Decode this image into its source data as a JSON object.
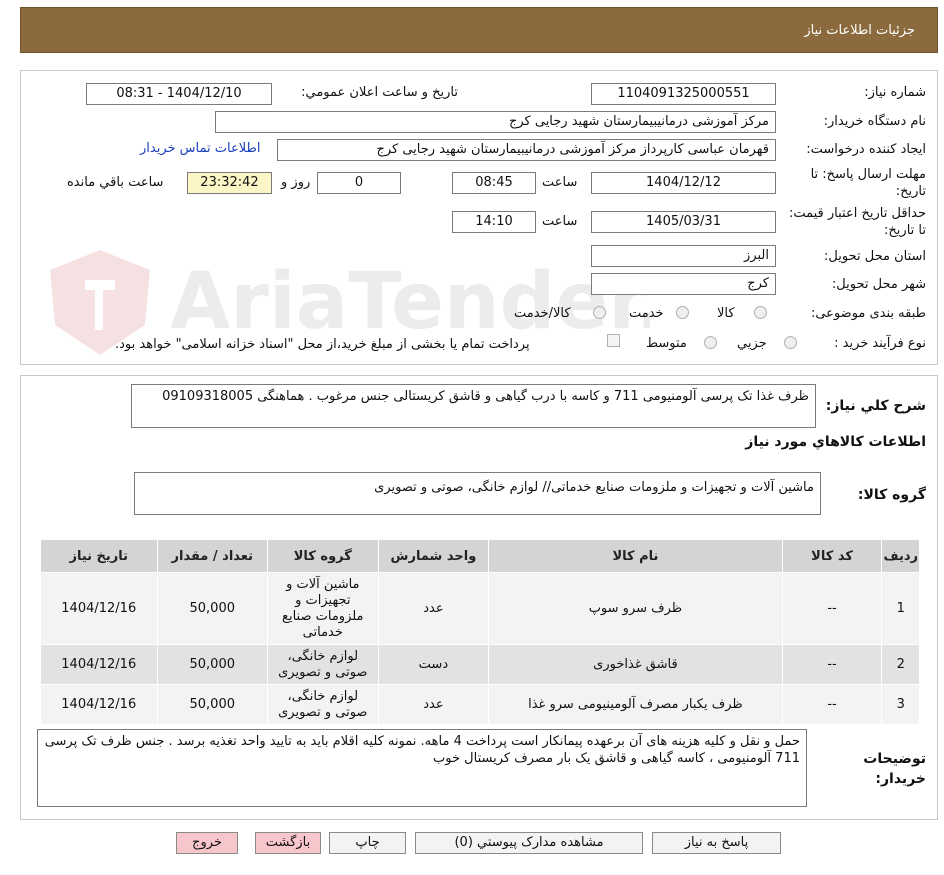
{
  "page": {
    "title": "جزئیات اطلاعات نیاز"
  },
  "fields": {
    "need_number_label": "شماره نیاز:",
    "need_number": "1104091325000551",
    "announce_label": "تاریخ و ساعت اعلان عمومي:",
    "announce_value": "1404/12/10 - 08:31",
    "buyer_org_label": "نام دستگاه خريدار:",
    "buyer_org": "مرکز آموزشی درمانیبیمارستان شهید رجایی کرج",
    "creator_label": "ايجاد کننده درخواست:",
    "creator": "قهرمان عباسی کارپرداز مرکز آموزشی درمانیبیمارستان شهید رجایی کرج",
    "contact_link": "اطلاعات تماس خريدار",
    "deadline_label": "مهلت ارسال پاسخ: تا تاریخ:",
    "deadline_date": "1404/12/12",
    "time_label": "ساعت",
    "deadline_time": "08:45",
    "days": "0",
    "days_label": "روز و",
    "remaining": "23:32:42",
    "remaining_label": "ساعت باقي مانده",
    "validity_label": "حداقل تاريخ اعتبار قيمت: تا تاريخ:",
    "validity_date": "1405/03/31",
    "validity_time": "14:10",
    "province_label": "استان محل تحویل:",
    "province": "البرز",
    "city_label": "شهر محل تحویل:",
    "city": "کرج",
    "category_label": "طبقه بندی موضوعی:",
    "category_options": [
      "کالا",
      "خدمت",
      "کالا/خدمت"
    ],
    "process_label": "نوع فرآیند خرید :",
    "process_options": [
      "جزیي",
      "متوسط"
    ],
    "payment_note": "پرداخت تمام یا بخشی از مبلغ خرید،از محل \"اسناد خزانه اسلامی\" خواهد بود."
  },
  "summary": {
    "label": "شرح کلي نياز:",
    "text": "ظرف  غذا تک پرسی  آلومنیومی 711 و کاسه با درب گیاهی و قاشق کریستالی جنس مرغوب  .  هماهنگی 09109318005"
  },
  "goods": {
    "section_title": "اطلاعات کالاهاي مورد نياز",
    "group_label": "گروه کالا:",
    "group_text": "ماشین آلات و تجهیزات و ملزومات صنایع خدماتی// لوازم خانگی، صوتی و تصویری"
  },
  "table": {
    "headers": [
      "رديف",
      "کد کالا",
      "نام کالا",
      "واحد شمارش",
      "گروه کالا",
      "تعداد / مقدار",
      "تاريخ نياز"
    ],
    "rows": [
      [
        "1",
        "--",
        "ظرف سرو سوپ",
        "عدد",
        "ماشین آلات و تجهیزات و ملزومات صنایع خدماتی",
        "50,000",
        "1404/12/16"
      ],
      [
        "2",
        "--",
        "قاشق غذاخوری",
        "دست",
        "لوازم خانگی، صوتی و تصویری",
        "50,000",
        "1404/12/16"
      ],
      [
        "3",
        "--",
        "ظرف یکبار مصرف آلومینیومی سرو غذا",
        "عدد",
        "لوازم خانگی، صوتی و تصویری",
        "50,000",
        "1404/12/16"
      ]
    ]
  },
  "notes": {
    "label": "توضيحات خريدار:",
    "text": "حمل و نقل و  کلیه هزینه های آن برعهده پیمانکار است پرداخت 4 ماهه. نمونه کلیه اقلام باید به تایید واحد تغذیه برسد . جنس ظرف تک پرسی 711 آلومنیومی ،  کاسه  گیاهی و قاشق یک بار مصرف کریستال خوب"
  },
  "buttons": {
    "reply": "پاسخ به نياز",
    "attachments": "مشاهده مدارک پیوستي (0)",
    "print": "چاپ",
    "back": "بازگشت",
    "exit": "خروج"
  },
  "watermark": {
    "text": "AriaTender.neT"
  },
  "colors": {
    "title_bar": "#8b6a3e",
    "button_pink": "#f7c6ca",
    "remaining_bg": "#fcf5c5",
    "link": "#1a3fbf"
  }
}
